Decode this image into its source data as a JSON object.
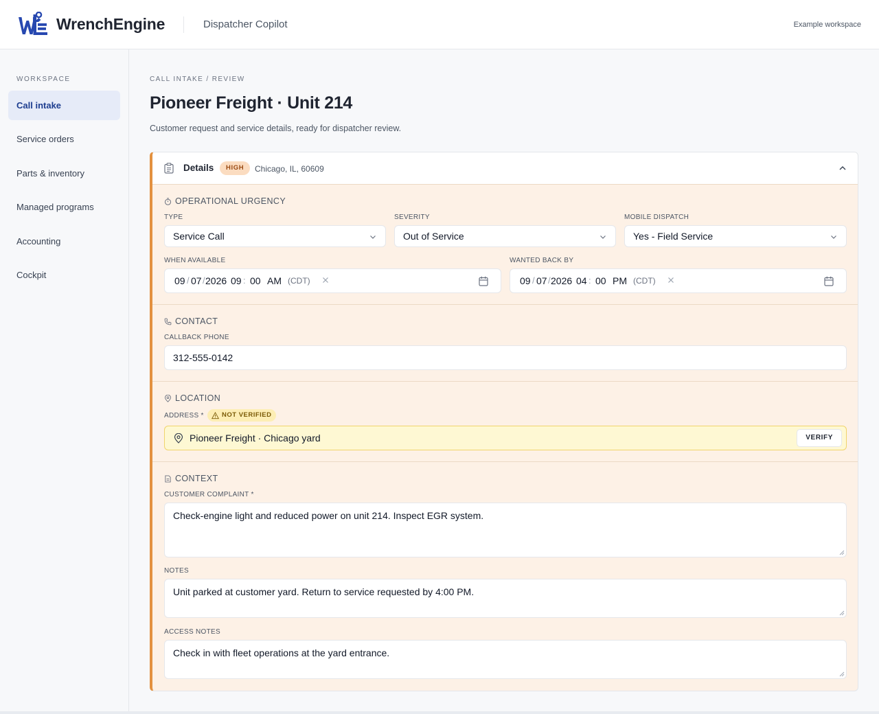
{
  "header": {
    "brand": "WrenchEngine",
    "app_name": "Dispatcher Copilot",
    "workspace_label": "Example workspace"
  },
  "sidebar": {
    "heading": "WORKSPACE",
    "items": [
      {
        "label": "Call intake",
        "active": true
      },
      {
        "label": "Service orders"
      },
      {
        "label": "Parts & inventory"
      },
      {
        "label": "Managed programs"
      },
      {
        "label": "Accounting"
      },
      {
        "label": "Cockpit"
      }
    ]
  },
  "page": {
    "breadcrumb": "CALL INTAKE / REVIEW",
    "title": "Pioneer Freight · Unit 214",
    "subtitle": "Customer request and service details, ready for dispatcher review."
  },
  "details": {
    "title": "Details",
    "priority": "HIGH",
    "location_summary": "Chicago, IL, 60609",
    "urgency": {
      "section_title": "OPERATIONAL URGENCY",
      "type_label": "TYPE",
      "type_value": "Service Call",
      "severity_label": "SEVERITY",
      "severity_value": "Out of Service",
      "dispatch_label": "MOBILE DISPATCH",
      "dispatch_value": "Yes - Field Service",
      "when_available": {
        "label": "WHEN AVAILABLE",
        "month": "09",
        "day": "07",
        "year": "2026",
        "hour": "09",
        "minute": "00",
        "ampm": "AM",
        "tz": "(CDT)"
      },
      "wanted_back_by": {
        "label": "WANTED BACK BY",
        "month": "09",
        "day": "07",
        "year": "2026",
        "hour": "04",
        "minute": "00",
        "ampm": "PM",
        "tz": "(CDT)"
      }
    },
    "contact": {
      "section_title": "CONTACT",
      "callback_label": "CALLBACK PHONE",
      "callback_value": "312-555-0142"
    },
    "location": {
      "section_title": "LOCATION",
      "address_label": "ADDRESS *",
      "verify_status": "NOT VERIFIED",
      "address_value": "Pioneer Freight · Chicago yard",
      "verify_button": "VERIFY"
    },
    "context": {
      "section_title": "CONTEXT",
      "complaint_label": "CUSTOMER COMPLAINT *",
      "complaint_value": "Check-engine light and reduced power on unit 214. Inspect EGR system.",
      "notes_label": "NOTES",
      "notes_value": "Unit parked at customer yard. Return to service requested by 4:00 PM.",
      "access_label": "ACCESS NOTES",
      "access_value": "Check in with fleet operations at the yard entrance."
    }
  },
  "colors": {
    "brand_blue": "#2748b0",
    "accent_orange": "#e3913f",
    "card_bg": "#fdf1e6",
    "warning_bg": "#fef8d3"
  }
}
